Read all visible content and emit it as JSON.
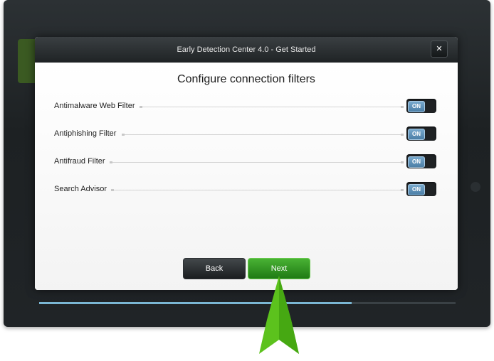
{
  "dialog": {
    "title": "Early Detection Center 4.0 - Get Started",
    "close_label": "✕",
    "heading": "Configure connection filters"
  },
  "filters": [
    {
      "label": "Antimalware Web Filter",
      "state": "ON"
    },
    {
      "label": "Antiphishing Filter",
      "state": "ON"
    },
    {
      "label": "Antifraud Filter",
      "state": "ON"
    },
    {
      "label": "Search Advisor",
      "state": "ON"
    }
  ],
  "buttons": {
    "back": "Back",
    "next": "Next"
  },
  "progress": {
    "fraction": 0.75
  },
  "colors": {
    "accent_green": "#2f9a1f",
    "toggle_blue": "#5d8fb6",
    "progress_blue": "#7bb7d4"
  }
}
